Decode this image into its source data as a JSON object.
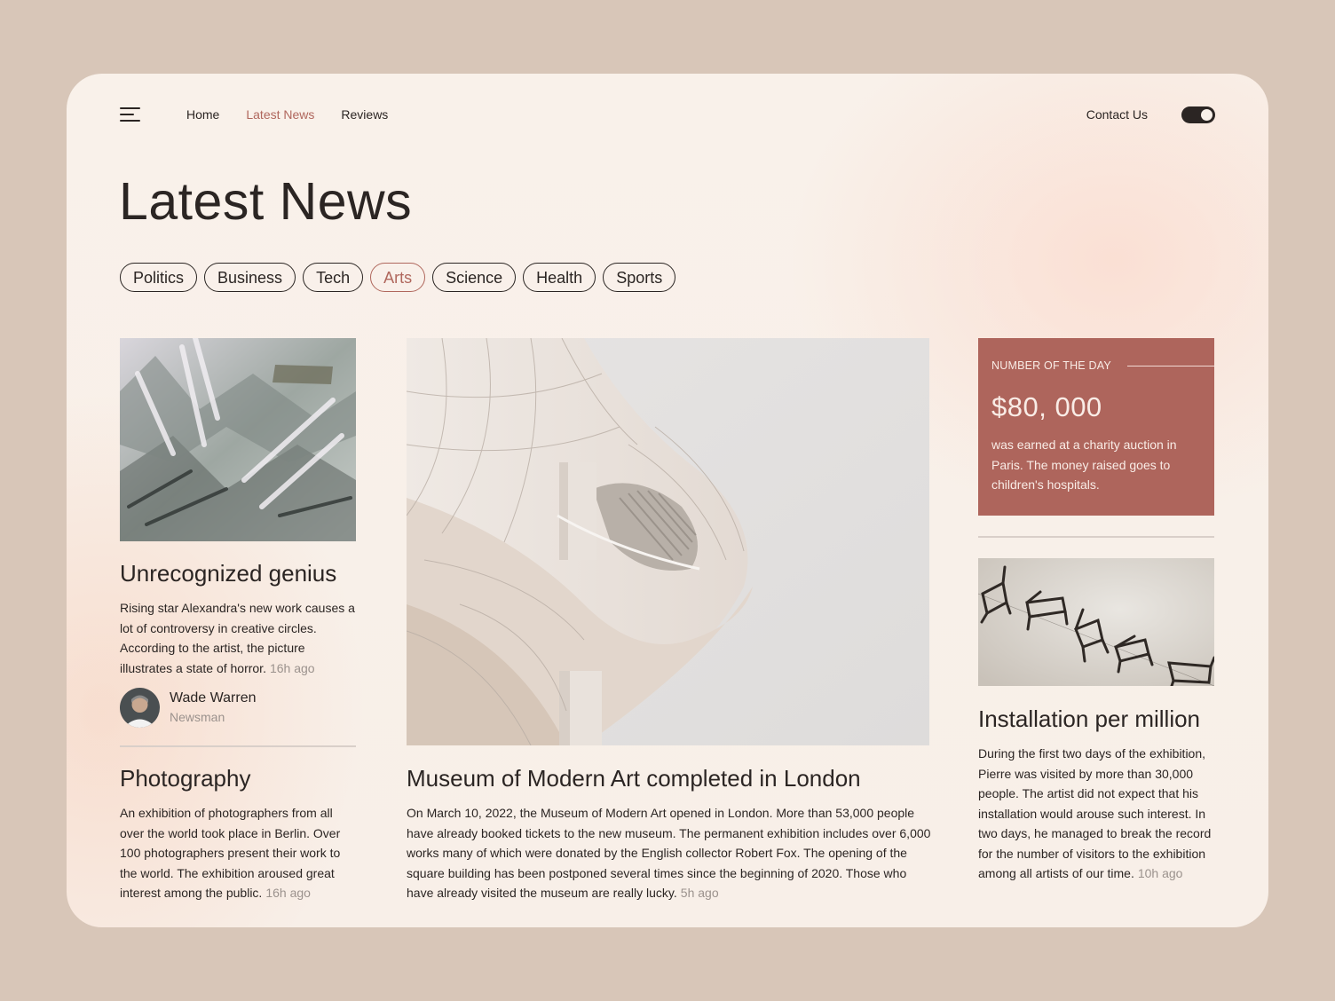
{
  "nav": {
    "home": "Home",
    "latest": "Latest News",
    "reviews": "Reviews",
    "contact": "Contact Us"
  },
  "page_title": "Latest News",
  "filters": [
    "Politics",
    "Business",
    "Tech",
    "Arts",
    "Science",
    "Health",
    "Sports"
  ],
  "active_filter": "Arts",
  "left": {
    "article1": {
      "title": "Unrecognized genius",
      "body": "Rising star Alexandra's new work causes a lot of controversy in creative circles. According to the artist, the picture illustrates a state of horror.",
      "time": "16h ago"
    },
    "author": {
      "name": "Wade Warren",
      "role": "Newsman"
    },
    "article2": {
      "title": "Photography",
      "body": "An exhibition of photographers from all over the world took place in Berlin. Over 100 photographers present their work to the world. The exhibition aroused great interest among the public.",
      "time": "16h ago"
    }
  },
  "center": {
    "title": "Museum of Modern Art completed in London",
    "body": "On March 10, 2022, the Museum of Modern Art opened in London. More than 53,000 people have already booked tickets to the new museum. The permanent exhibition includes over 6,000 works many of which were donated by the English collector Robert Fox. The opening of the square building has been postponed several times since the beginning of 2020. Those who have already visited the museum are really lucky.",
    "time": "5h ago"
  },
  "right": {
    "number_card": {
      "label": "NUMBER OF THE DAY",
      "value": "$80, 000",
      "text": "was earned at a charity auction in Paris. The money raised goes to children's hospitals."
    },
    "article": {
      "title": "Installation per million",
      "body": "During the first two days of the exhibition, Pierre was visited by more than 30,000 people. The artist did not expect that his installation would arouse such interest. In two days, he managed to break the record for the number of visitors to the exhibition among all artists of our time.",
      "time": "10h ago"
    }
  },
  "colors": {
    "accent": "#b0675d",
    "card_red": "#ae655c",
    "text": "#2b2523",
    "muted": "#9b928d",
    "background": "#d8c6b8"
  },
  "icons": [
    "hamburger-menu-icon",
    "theme-toggle"
  ]
}
